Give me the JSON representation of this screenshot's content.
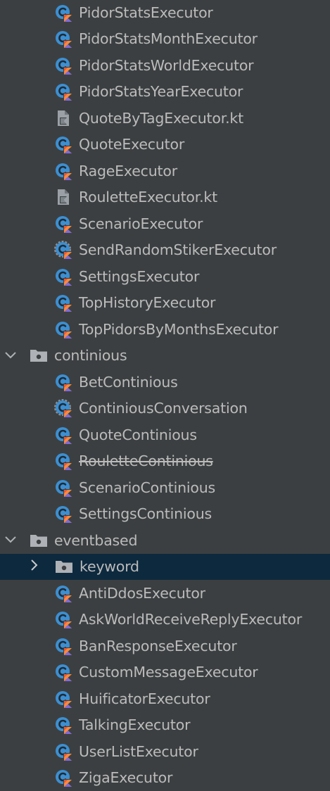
{
  "tree": {
    "items": [
      {
        "type": "class",
        "label": "PidorStatsExecutor"
      },
      {
        "type": "class",
        "label": "PidorStatsMonthExecutor"
      },
      {
        "type": "class",
        "label": "PidorStatsWorldExecutor"
      },
      {
        "type": "class",
        "label": "PidorStatsYearExecutor"
      },
      {
        "type": "file",
        "label": "QuoteByTagExecutor.kt"
      },
      {
        "type": "class",
        "label": "QuoteExecutor"
      },
      {
        "type": "class",
        "label": "RageExecutor"
      },
      {
        "type": "file",
        "label": "RouletteExecutor.kt"
      },
      {
        "type": "class",
        "label": "ScenarioExecutor"
      },
      {
        "type": "class-abstract",
        "label": "SendRandomStikerExecutor"
      },
      {
        "type": "class",
        "label": "SettingsExecutor"
      },
      {
        "type": "class",
        "label": "TopHistoryExecutor"
      },
      {
        "type": "class",
        "label": "TopPidorsByMonthsExecutor"
      },
      {
        "type": "folder",
        "label": "continious",
        "expanded": true
      },
      {
        "type": "class",
        "label": "BetContinious"
      },
      {
        "type": "class-abstract",
        "label": "ContiniousConversation"
      },
      {
        "type": "class",
        "label": "QuoteContinious"
      },
      {
        "type": "class-deprecated",
        "label": "RouletteContinious"
      },
      {
        "type": "class",
        "label": "ScenarioContinious"
      },
      {
        "type": "class",
        "label": "SettingsContinious"
      },
      {
        "type": "folder",
        "label": "eventbased",
        "expanded": true
      },
      {
        "type": "subfolder",
        "label": "keyword",
        "expanded": false,
        "selected": true
      },
      {
        "type": "class",
        "label": "AntiDdosExecutor"
      },
      {
        "type": "class",
        "label": "AskWorldReceiveReplyExecutor"
      },
      {
        "type": "class",
        "label": "BanResponseExecutor"
      },
      {
        "type": "class",
        "label": "CustomMessageExecutor"
      },
      {
        "type": "class",
        "label": "HuificatorExecutor"
      },
      {
        "type": "class",
        "label": "TalkingExecutor"
      },
      {
        "type": "class",
        "label": "UserListExecutor"
      },
      {
        "type": "class",
        "label": "ZigaExecutor"
      }
    ]
  },
  "icons": {
    "chevron_down": "⌵",
    "chevron_right": "❯"
  },
  "colors": {
    "background": "#3c3f41",
    "selected_row": "#0d293e",
    "text": "#bbbbbb",
    "class_icon": "#3d8fd1",
    "kotlin_orange": "#f88a3c",
    "kotlin_purple": "#7f6bd8",
    "file_icon": "#9aa0a6",
    "folder_icon": "#aeb2b6"
  }
}
